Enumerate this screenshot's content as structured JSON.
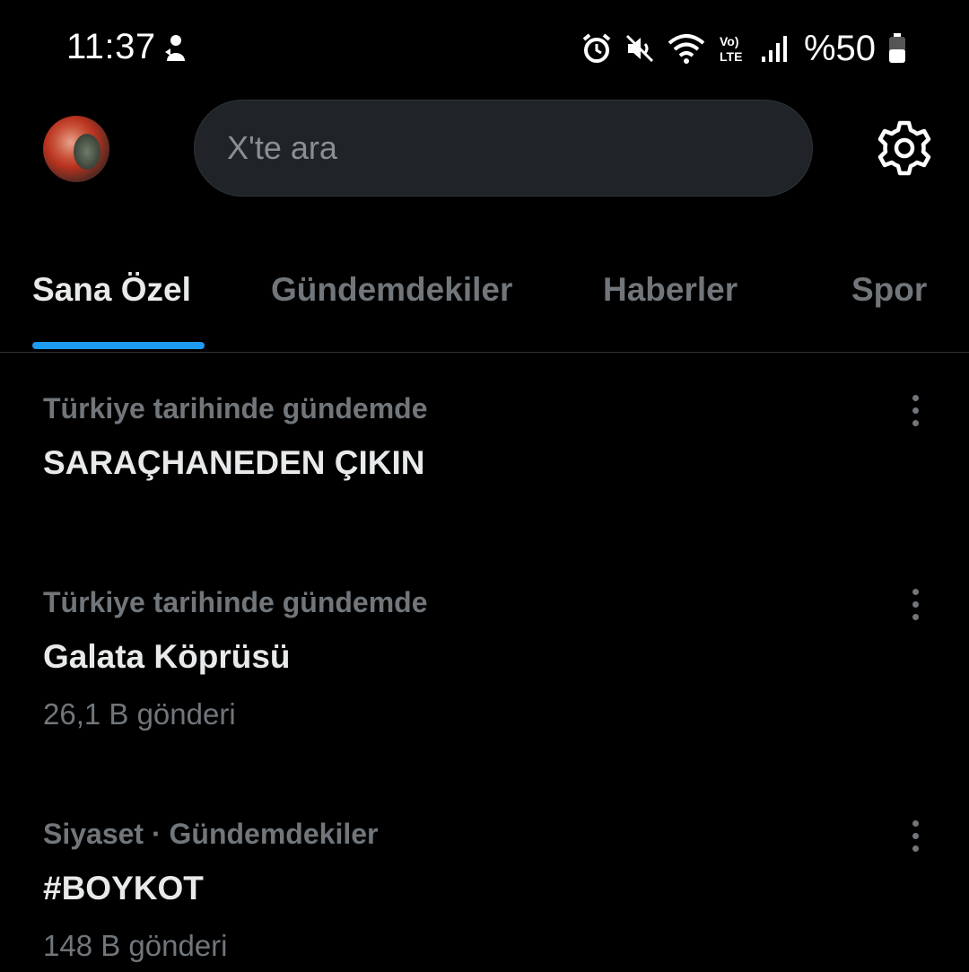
{
  "status_bar": {
    "time": "11:37",
    "battery": "%50",
    "icons": [
      "app-notification-icon",
      "alarm-icon",
      "mute-icon",
      "wifi-icon",
      "volte-icon",
      "signal-icon",
      "battery-icon"
    ]
  },
  "header": {
    "search_placeholder": "X'te ara",
    "icons": [
      "avatar",
      "settings-gear-icon"
    ]
  },
  "tabs": [
    {
      "label": "Sana Özel",
      "active": true
    },
    {
      "label": "Gündemdekiler",
      "active": false
    },
    {
      "label": "Haberler",
      "active": false
    },
    {
      "label": "Spor",
      "active": false
    }
  ],
  "trends": [
    {
      "context": "Türkiye tarihinde gündemde",
      "title": "SARAÇHANEDEN ÇIKIN",
      "count": ""
    },
    {
      "context": "Türkiye tarihinde gündemde",
      "title": "Galata Köprüsü",
      "count": "26,1 B gönderi"
    },
    {
      "context": "Siyaset · Gündemdekiler",
      "title": "#BOYKOT",
      "count": "148 B gönderi"
    }
  ],
  "colors": {
    "background": "#000000",
    "accent": "#1d9bf0",
    "primary_text": "#e7e9ea",
    "secondary_text": "#71767b",
    "search_bg": "#202327"
  }
}
